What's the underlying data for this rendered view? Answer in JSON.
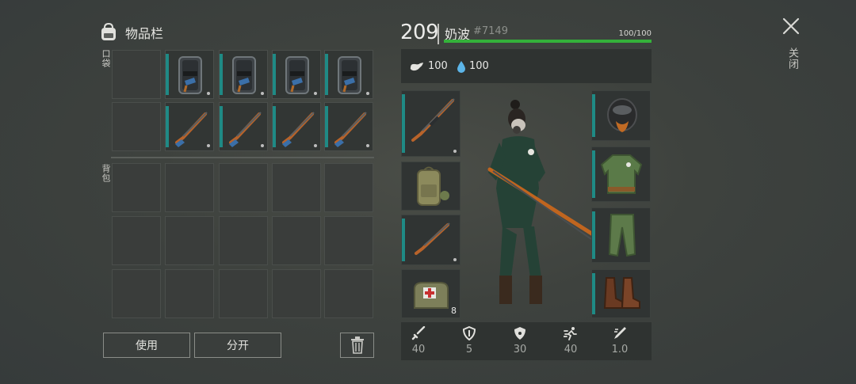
{
  "inventory": {
    "title": "物品栏",
    "pockets_label": "口袋",
    "backpack_label": "背包",
    "pocket_rows": [
      [
        {
          "item": "empty"
        },
        {
          "item": "police-riot-shield",
          "label": "POLICE"
        },
        {
          "item": "police-riot-shield",
          "label": "POLICE"
        },
        {
          "item": "police-riot-shield",
          "label": "POLICE"
        },
        {
          "item": "police-riot-shield",
          "label": "POLICE"
        }
      ],
      [
        {
          "item": "empty"
        },
        {
          "item": "hunting-rifle"
        },
        {
          "item": "hunting-rifle"
        },
        {
          "item": "hunting-rifle"
        },
        {
          "item": "hunting-rifle"
        }
      ]
    ],
    "backpack_rows": 3,
    "backpack_cols": 5,
    "use_button": "使用",
    "split_button": "分开",
    "trash_icon": "trash-icon"
  },
  "character": {
    "level": "209",
    "name": "奶波",
    "id": "#7149",
    "hp_text": "100/100",
    "hp_fraction": 1.0,
    "food_icon": "stomach-icon",
    "food": "100",
    "water_icon": "water-drop-icon",
    "water": "100",
    "left_slots": [
      {
        "slot": "primary-weapon",
        "item": "sniper-rifle"
      },
      {
        "slot": "backpack",
        "item": "military-backpack"
      },
      {
        "slot": "secondary-weapon",
        "item": "sniper-rifle"
      },
      {
        "slot": "medkit",
        "item": "medical-bag",
        "count": "8"
      }
    ],
    "right_slots": [
      {
        "slot": "head",
        "item": "gas-mask"
      },
      {
        "slot": "body",
        "item": "military-jacket"
      },
      {
        "slot": "legs",
        "item": "military-pants"
      },
      {
        "slot": "feet",
        "item": "leather-boots"
      }
    ],
    "attributes": [
      {
        "icon": "damage-icon",
        "value": "40"
      },
      {
        "icon": "armor-icon",
        "value": "5"
      },
      {
        "icon": "radiation-protection-icon",
        "value": "30"
      },
      {
        "icon": "speed-icon",
        "value": "40"
      },
      {
        "icon": "stealth-icon",
        "value": "1.0"
      }
    ]
  },
  "close": {
    "icon": "close-icon",
    "label": "关闭"
  },
  "colors": {
    "condition_bar": "#1f8a85",
    "hp_fill": "#34b13a",
    "water_drop": "#5cb5e8"
  }
}
